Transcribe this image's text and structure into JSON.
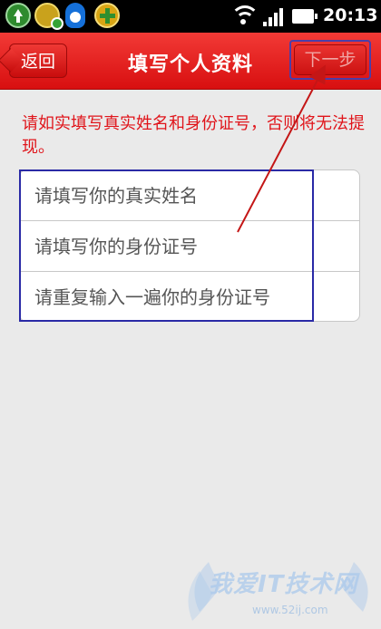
{
  "status_bar": {
    "time": "20:13",
    "icons": [
      "update-icon",
      "security-shield-icon",
      "qq-icon",
      "plus-icon",
      "wifi-icon",
      "signal-icon",
      "battery-icon"
    ]
  },
  "header": {
    "back_label": "返回",
    "title": "填写个人资料",
    "next_label": "下一步",
    "background_color": "#e01f1e"
  },
  "hint": {
    "text": "请如实填写真实姓名和身份证号，否则将无法提现。",
    "color": "#e0141a"
  },
  "form": {
    "fields": [
      {
        "placeholder": "请填写你的真实姓名"
      },
      {
        "placeholder": "请填写你的身份证号"
      },
      {
        "placeholder": "请重复输入一遍你的身份证号"
      }
    ]
  },
  "watermark": {
    "text": "我爱IT技术网",
    "url": "www.52ij.com"
  }
}
